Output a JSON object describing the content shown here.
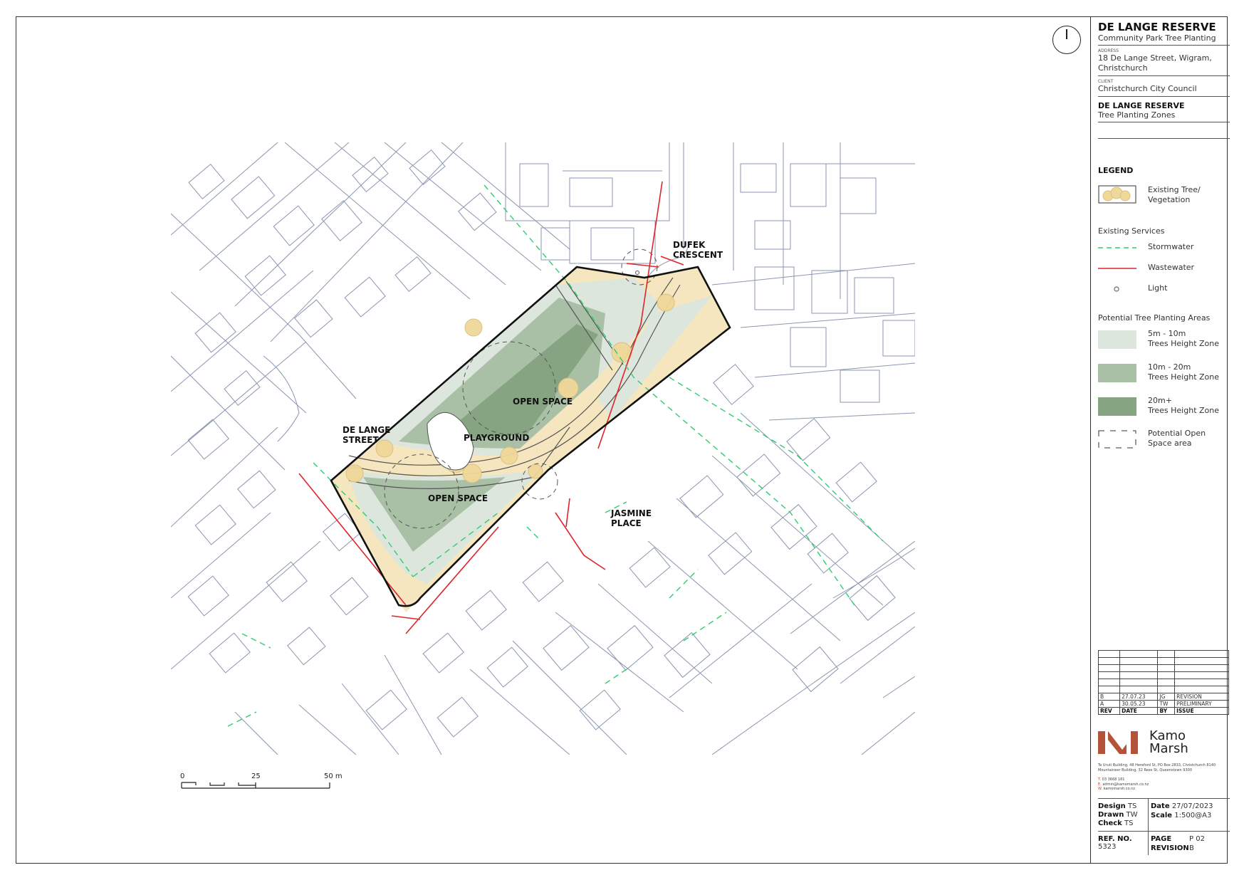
{
  "project": {
    "title": "DE LANGE RESERVE",
    "subtitle": "Community Park Tree Planting",
    "address_caption": "ADDRESS",
    "address": "18 De Lange Street, Wigram, Christchurch",
    "client_caption": "CLIENT",
    "client": "Christchurch City Council",
    "sheet_title": "DE LANGE RESERVE",
    "sheet_subtitle": "Tree Planting Zones"
  },
  "legend": {
    "heading": "LEGEND",
    "vegetation_label": "Existing Tree/\nVegetation",
    "services_heading": "Existing Services",
    "stormwater_label": "Stormwater",
    "wastewater_label": "Wastewater",
    "light_label": "Light",
    "planting_heading": "Potential Tree Planting Areas",
    "zone_small_label": "5m - 10m\nTrees Height Zone",
    "zone_medium_label": "10m - 20m\nTrees Height Zone",
    "zone_large_label": "20m+\nTrees Height Zone",
    "open_space_label": "Potential Open\nSpace area"
  },
  "colors": {
    "zone_small": "#dde6dd",
    "zone_medium": "#a9c0a6",
    "zone_large": "#86a481",
    "vegetation": "#f4e3b8",
    "stormwater": "#2ecc71",
    "wastewater": "#e0242a",
    "parcel_line": "#8a95b0",
    "brand": "#b5533a"
  },
  "map_labels": {
    "dufek": "DUFEK\nCRESCENT",
    "de_lange": "DE LANGE\nSTREET",
    "jasmine": "JASMINE\nPLACE",
    "open_space_1": "OPEN SPACE",
    "open_space_2": "OPEN SPACE",
    "playground": "PLAYGROUND"
  },
  "scale_bar": {
    "ticks": [
      "0",
      "25",
      "50 m"
    ]
  },
  "revisions": {
    "header": [
      "REV",
      "DATE",
      "BY",
      "ISSUE"
    ],
    "rows": [
      [
        "B",
        "27.07.23",
        "JG",
        "REVISION"
      ],
      [
        "A",
        "30.05.23",
        "TW",
        "PRELIMINARY"
      ]
    ]
  },
  "company": {
    "name": "Kamo\nMarsh",
    "address": "Te Uruti Building, 48 Hereford St, PO Box 2833, Christchurch 8140 Mountaineer Building, 32 Rees St, Queenstown 9300",
    "phone_key": "T.",
    "phone": "03 3668 181",
    "email_key": "E.",
    "email": "admin@kamomarsh.co.nz",
    "web_key": "W.",
    "web": "kamomarsh.co.nz"
  },
  "meta": {
    "design_label": "Design",
    "design_value": "TS",
    "drawn_label": "Drawn",
    "drawn_value": "TW",
    "check_label": "Check",
    "check_value": "TS",
    "date_label": "Date",
    "date_value": "27/07/2023",
    "scale_label": "Scale",
    "scale_value": "1:500@A3",
    "ref_label": "REF. NO.",
    "ref_value": "5323",
    "page_label": "PAGE",
    "page_value": "P 02",
    "revision_label": "REVISION",
    "revision_value": "B"
  }
}
